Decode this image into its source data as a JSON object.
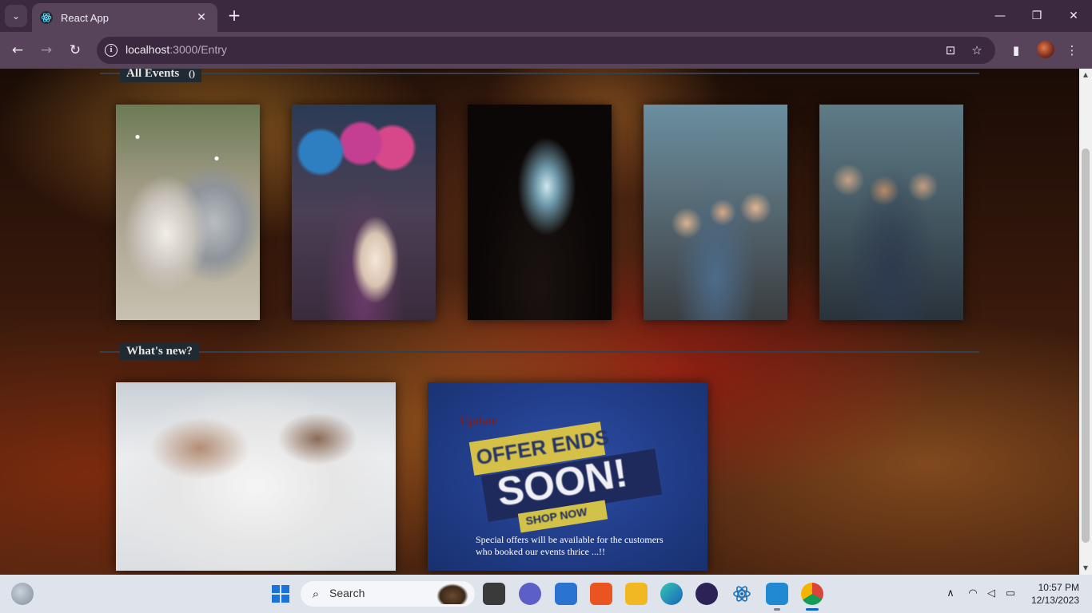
{
  "browser": {
    "tab": {
      "title": "React App",
      "close_glyph": "✕",
      "favicon_icon": "react-icon"
    },
    "tab_search_glyph": "⌄",
    "new_tab_glyph": "+",
    "window_controls": {
      "minimize": "—",
      "maximize": "❐",
      "close": "✕"
    },
    "nav": {
      "back": "←",
      "forward": "→",
      "reload": "↻"
    },
    "address": {
      "host": "localhost",
      "path": ":3000/Entry"
    },
    "icons": {
      "install": "⊡",
      "bookmark": "☆",
      "side_panel": "▮",
      "menu": "⋮",
      "site_info": "i"
    }
  },
  "page": {
    "all_events": {
      "title": "All Events",
      "count": "()"
    },
    "events": [
      {
        "name": "wedding-photo"
      },
      {
        "name": "birthday-photo"
      },
      {
        "name": "concert-photo"
      },
      {
        "name": "office-party-photo"
      },
      {
        "name": "crowd-photo"
      }
    ],
    "whats_new": {
      "title": "What's new?"
    },
    "update": {
      "label": "Update",
      "banner_line1": "OFFER ENDS",
      "banner_line2": "SOON!",
      "banner_line3": "SHOP NOW",
      "description": "Special offers will be available for the customers who booked our events thrice ...!!"
    }
  },
  "scrollbar": {
    "up": "▲",
    "down": "▼"
  },
  "taskbar": {
    "search_placeholder": "Search",
    "search_glyph": "⌕",
    "clock": {
      "time": "10:57 PM",
      "date": "12/13/2023"
    },
    "tray": {
      "chevron": "∧",
      "wifi": "◠",
      "volume": "◁",
      "battery": "▭"
    },
    "apps": [
      "start",
      "task-view",
      "chat",
      "notepad",
      "ubuntu",
      "file-explorer",
      "edge",
      "eclipse",
      "react",
      "vscode",
      "chrome"
    ]
  },
  "colors": {
    "titlebar": "#3b2a3f",
    "toolbar": "#57445b",
    "section_title_bg": "#1f2a33",
    "update_label": "#7a1f24",
    "taskbar": "#dfe4ec"
  }
}
